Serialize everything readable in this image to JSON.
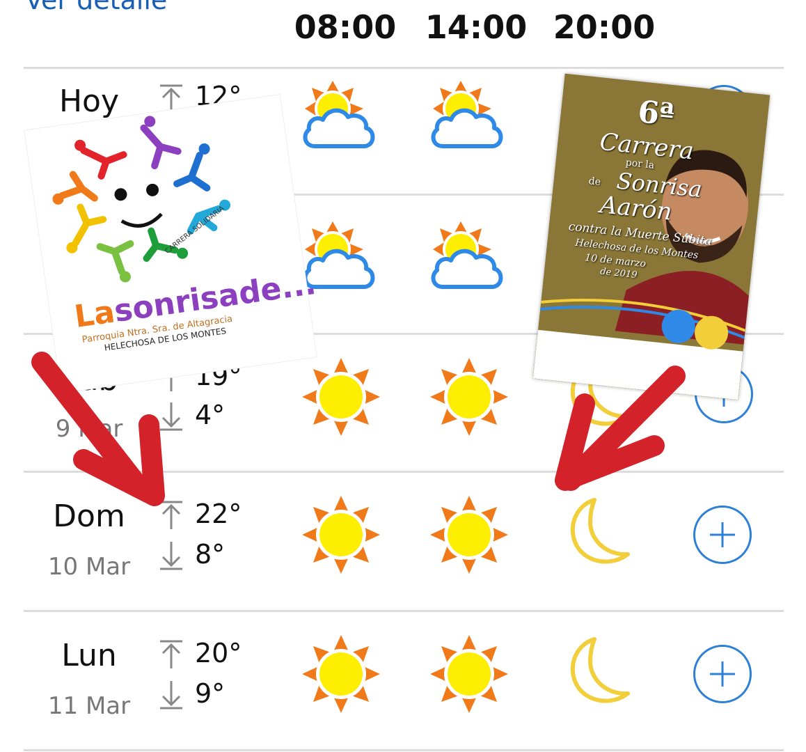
{
  "header": {
    "detail_link": "Ver detalle",
    "hours": [
      "08:00",
      "14:00",
      "20:00"
    ]
  },
  "colors": {
    "link": "#1a5fb4",
    "sun_orange": "#f07a1a",
    "sun_yellow": "#fdee02",
    "cloud_blue": "#2e8ae6",
    "moon_yellow": "#f2cf3a",
    "plus_blue": "#2e7fd6",
    "arrow_red": "#d3222a"
  },
  "days": [
    {
      "name": "Hoy",
      "date": "",
      "max": "12°",
      "min": "",
      "icons": [
        "sun-cloud-icon",
        "sun-cloud-icon",
        "moon-cloud-icon"
      ]
    },
    {
      "name": "",
      "date": "",
      "max": "",
      "min": "",
      "icons": [
        "sun-cloud-icon",
        "sun-cloud-icon",
        ""
      ]
    },
    {
      "name": "Sab",
      "date": "9 Mar",
      "max": "19°",
      "min": "4°",
      "icons": [
        "sun-icon",
        "sun-icon",
        "moon-icon"
      ]
    },
    {
      "name": "Dom",
      "date": "10 Mar",
      "max": "22°",
      "min": "8°",
      "icons": [
        "sun-icon",
        "sun-icon",
        "moon-icon"
      ]
    },
    {
      "name": "Lun",
      "date": "11 Mar",
      "max": "20°",
      "min": "9°",
      "icons": [
        "sun-icon",
        "sun-icon",
        "moon-icon"
      ]
    }
  ],
  "logo_overlay": {
    "title_la": "La",
    "title_sonrisa": "sonrisa",
    "title_de": "de...",
    "parish": "Parroquia Ntra. Sra. de Altagracia",
    "town": "HELECHOSA DE LOS MONTES",
    "ring_text": "CARRERA SOLIDARIA"
  },
  "poster_overlay": {
    "edition": "6ª",
    "line1": "Carrera",
    "line2": "por la",
    "line3": "Sonrisa",
    "line4": "de",
    "line5": "Aarón",
    "line6": "contra la Muerte Súbita",
    "line7": "Helechosa de los Montes",
    "line8": "10 de marzo",
    "line9": "de 2019"
  }
}
